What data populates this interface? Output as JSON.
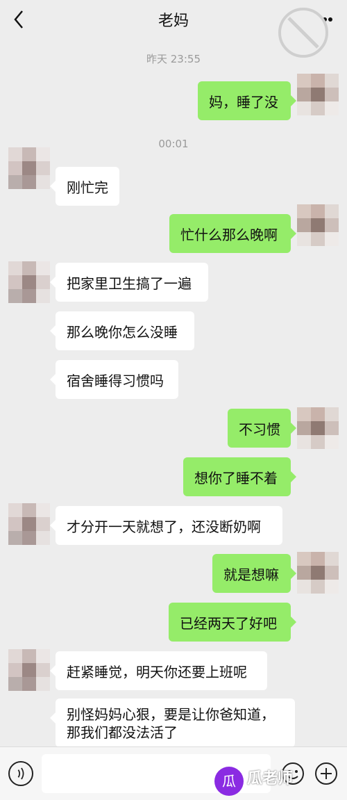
{
  "header": {
    "title": "老妈"
  },
  "timestamps": [
    "昨天 23:55",
    "00:01"
  ],
  "messages": [
    {
      "side": "right",
      "text": "妈，睡了没"
    },
    {
      "side": "left",
      "text": "刚忙完"
    },
    {
      "side": "right",
      "text": "忙什么那么晚啊"
    },
    {
      "side": "left",
      "text": "把家里卫生搞了一遍"
    },
    {
      "side": "left",
      "text": "那么晚你怎么没睡"
    },
    {
      "side": "left",
      "text": "宿舍睡得习惯吗"
    },
    {
      "side": "right",
      "text": "不习惯"
    },
    {
      "side": "right",
      "text": "想你了睡不着"
    },
    {
      "side": "left",
      "text": "才分开一天就想了，还没断奶啊"
    },
    {
      "side": "right",
      "text": "就是想嘛"
    },
    {
      "side": "right",
      "text": "已经两天了好吧"
    },
    {
      "side": "left",
      "text": "赶紧睡觉，明天你还要上班呢"
    },
    {
      "side": "left",
      "text": "别怪妈妈心狠，要是让你爸知道，那我们都没法活了"
    }
  ],
  "watermarks": {
    "bottom_text": "瓜老师"
  },
  "colors": {
    "background": "#ededed",
    "bubble_sent": "#95ec69",
    "bubble_received": "#ffffff"
  },
  "icons": [
    "back-icon",
    "more-icon",
    "voice-icon",
    "emoji-icon",
    "plus-icon"
  ]
}
